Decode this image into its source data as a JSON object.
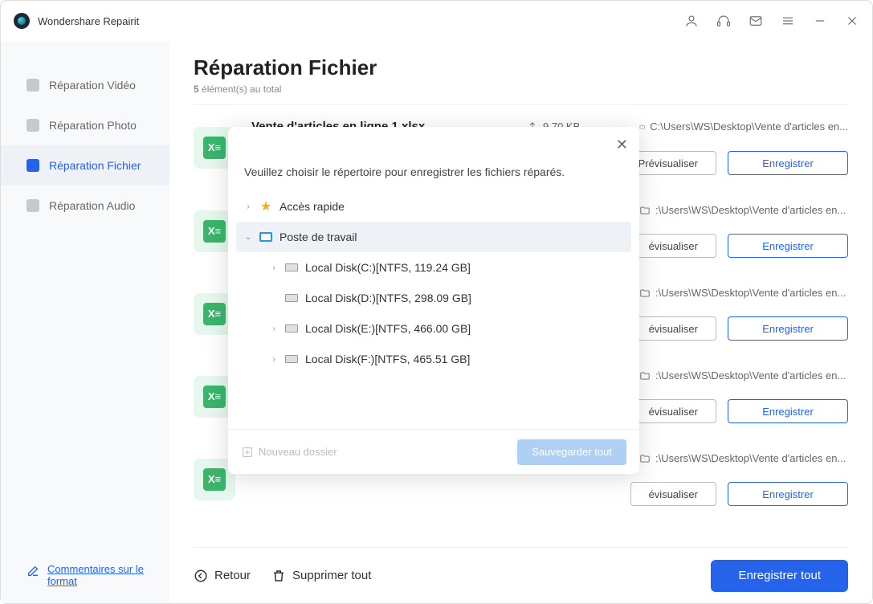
{
  "app_title": "Wondershare Repairit",
  "sidebar": {
    "items": [
      {
        "label": "Réparation Vidéo"
      },
      {
        "label": "Réparation Photo"
      },
      {
        "label": "Réparation Fichier"
      },
      {
        "label": "Réparation Audio"
      }
    ],
    "feedback_label": "Commentaires sur le format"
  },
  "page": {
    "title": "Réparation Fichier",
    "count": "5",
    "count_label": "élément(s) au total"
  },
  "actions": {
    "preview": "Prévisualiser",
    "save": "Enregistrer"
  },
  "files": [
    {
      "name": "Vente d'articles en ligne 1.xlsx",
      "size": "9.70  KB",
      "path": "C:\\Users\\WS\\Desktop\\Vente d'articles en..."
    },
    {
      "name": "",
      "size": "",
      "path": ":\\Users\\WS\\Desktop\\Vente d'articles en..."
    },
    {
      "name": "",
      "size": "",
      "path": ":\\Users\\WS\\Desktop\\Vente d'articles en..."
    },
    {
      "name": "",
      "size": "",
      "path": ":\\Users\\WS\\Desktop\\Vente d'articles en..."
    },
    {
      "name": "",
      "size": "",
      "path": ":\\Users\\WS\\Desktop\\Vente d'articles en..."
    }
  ],
  "footer": {
    "back": "Retour",
    "delete_all": "Supprimer tout",
    "save_all": "Enregistrer tout"
  },
  "dialog": {
    "message": "Veuillez choisir le répertoire pour enregistrer les fichiers réparés.",
    "quick_access": "Accès rapide",
    "this_pc": "Poste de travail",
    "disks": [
      "Local Disk(C:)[NTFS, 119.24  GB]",
      "Local Disk(D:)[NTFS, 298.09  GB]",
      "Local Disk(E:)[NTFS, 466.00  GB]",
      "Local Disk(F:)[NTFS, 465.51  GB]"
    ],
    "new_folder": "Nouveau dossier",
    "save_all": "Sauvegarder tout"
  }
}
